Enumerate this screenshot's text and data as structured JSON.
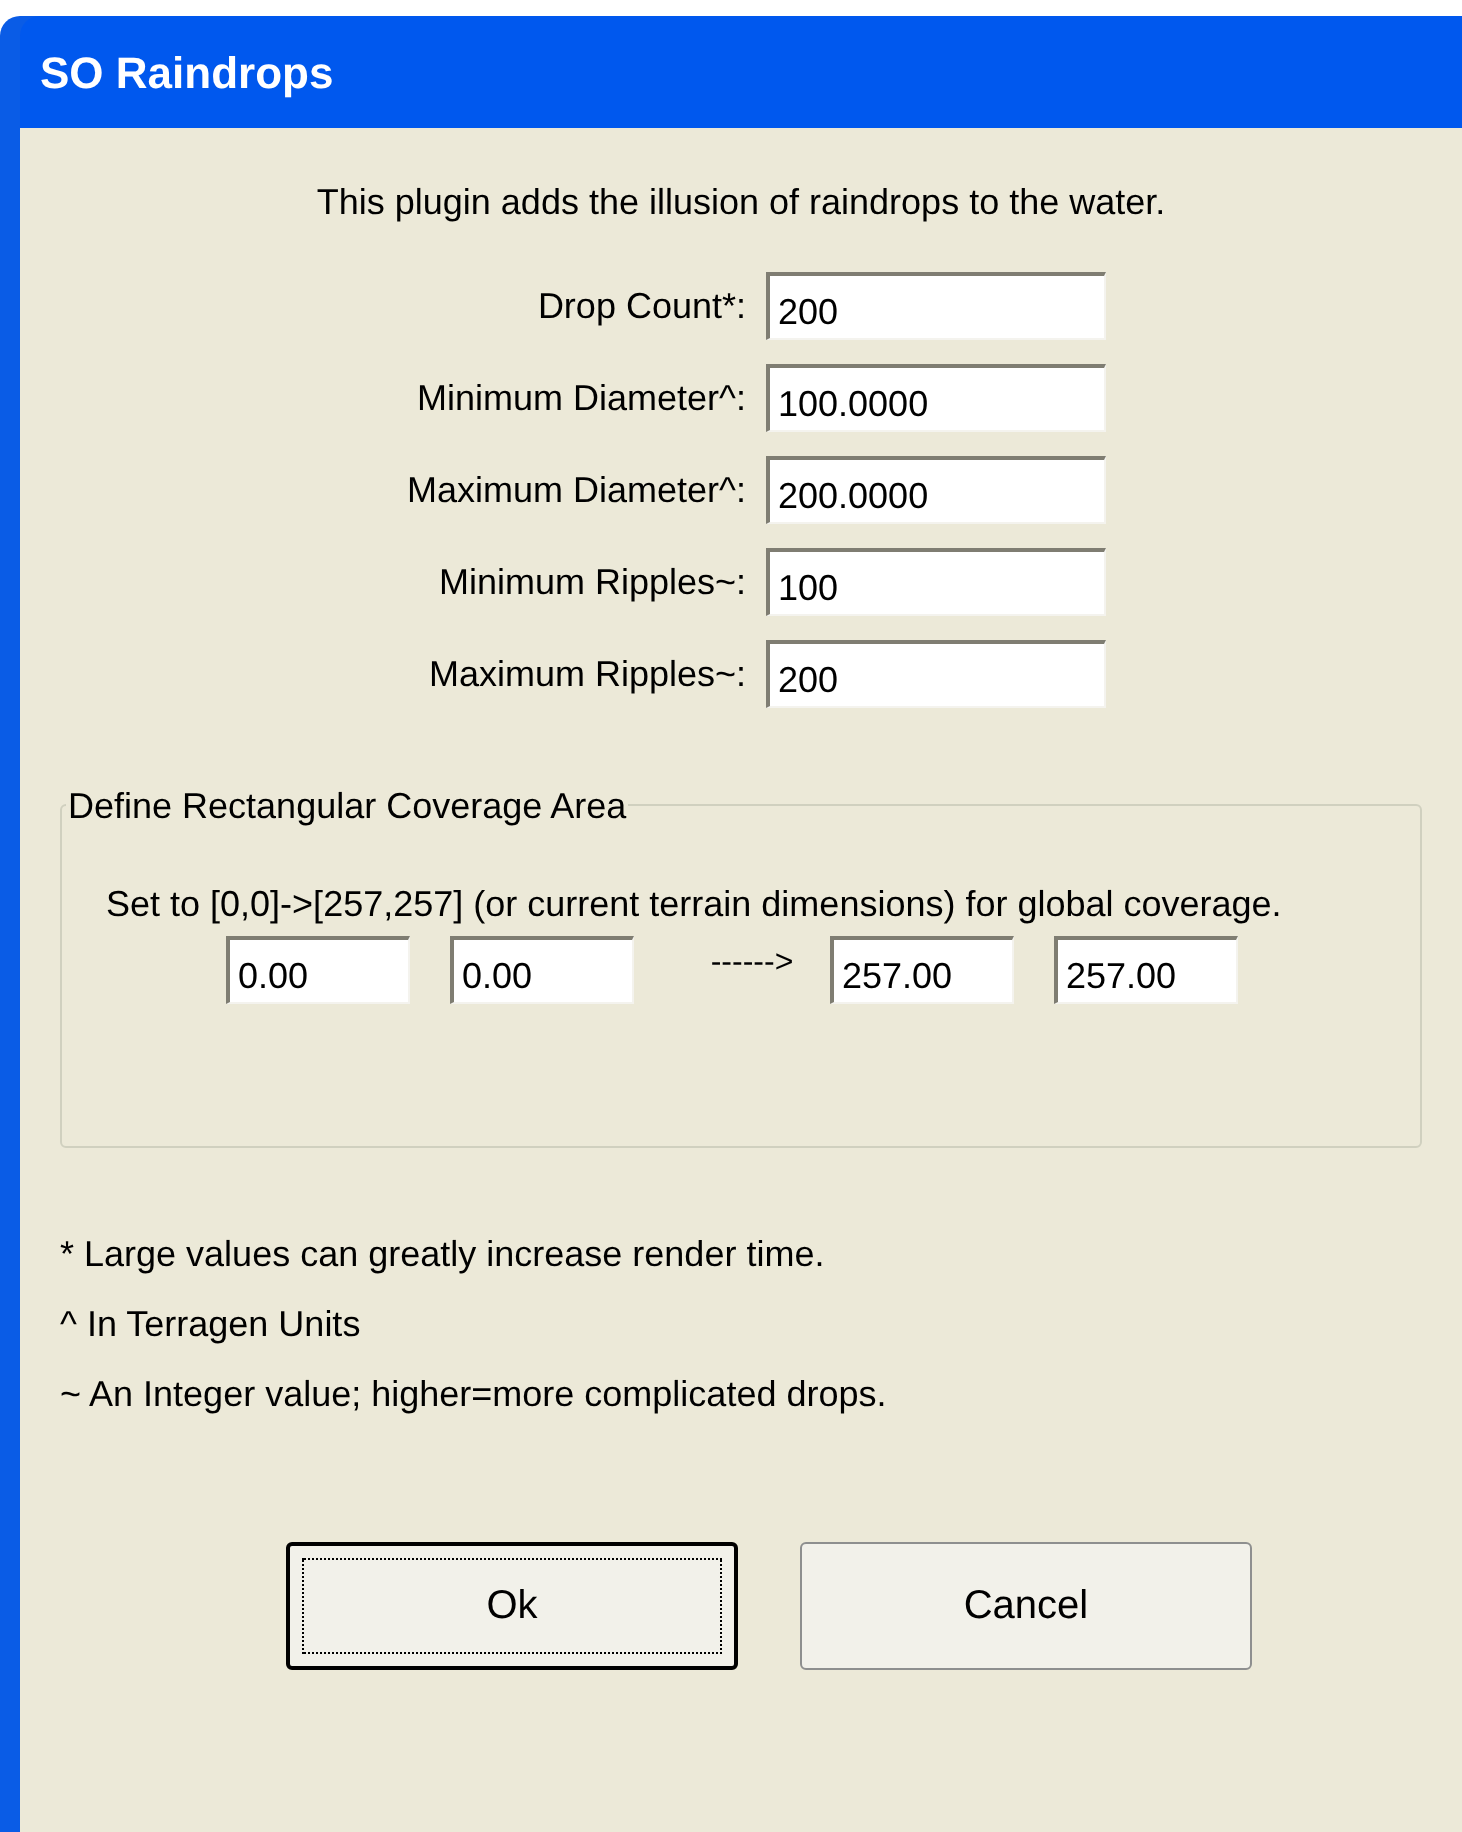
{
  "window": {
    "title": "SO Raindrops"
  },
  "intro": "This plugin adds the illusion of raindrops to the water.",
  "fields": [
    {
      "label": "Drop Count*:",
      "value": "200"
    },
    {
      "label": "Minimum Diameter^:",
      "value": "100.0000"
    },
    {
      "label": "Maximum Diameter^:",
      "value": "200.0000"
    },
    {
      "label": "Minimum Ripples~:",
      "value": "100"
    },
    {
      "label": "Maximum Ripples~:",
      "value": "200"
    }
  ],
  "coverage": {
    "title": "Define Rectangular Coverage Area",
    "description": "Set to [0,0]->[257,257] (or current terrain dimensions) for global coverage.",
    "from": [
      "0.00",
      "0.00"
    ],
    "arrow": "------>",
    "to": [
      "257.00",
      "257.00"
    ]
  },
  "notes": [
    "* Large values can greatly increase render time.",
    "^ In Terragen Units",
    "~ An Integer value; higher=more complicated drops."
  ],
  "buttons": [
    {
      "label": "Ok",
      "focused": true
    },
    {
      "label": "Cancel",
      "focused": false
    }
  ]
}
